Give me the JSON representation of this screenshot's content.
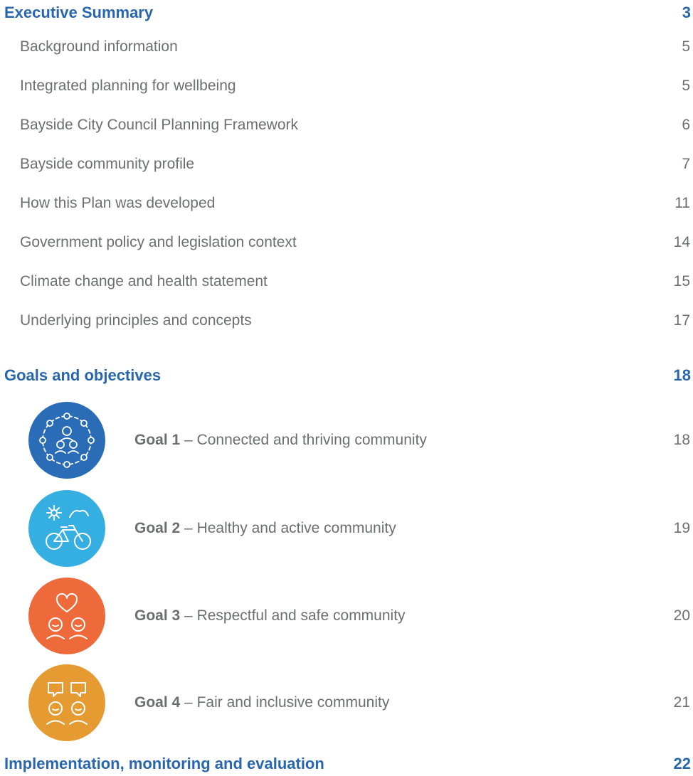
{
  "toc": {
    "executive_summary": {
      "label": "Executive Summary",
      "page": "3"
    },
    "entries": [
      {
        "label": "Background information",
        "page": "5"
      },
      {
        "label": "Integrated planning for wellbeing",
        "page": "5"
      },
      {
        "label": "Bayside City Council Planning Framework",
        "page": "6"
      },
      {
        "label": "Bayside community profile",
        "page": "7"
      },
      {
        "label": "How this Plan was developed",
        "page": "11"
      },
      {
        "label": "Government policy and legislation context",
        "page": "14"
      },
      {
        "label": "Climate change and health statement",
        "page": "15"
      },
      {
        "label": "Underlying principles and concepts",
        "page": "17"
      }
    ],
    "goals_heading": {
      "label": "Goals and objectives",
      "page": "18"
    },
    "goals": [
      {
        "number": "Goal 1",
        "separator": " – ",
        "title": "Connected and thriving community",
        "page": "18",
        "icon": "community-network-icon",
        "color": "#2a6cb5"
      },
      {
        "number": "Goal 2",
        "separator": " – ",
        "title": "Healthy and active community",
        "page": "19",
        "icon": "bicycle-sun-icon",
        "color": "#35aee2"
      },
      {
        "number": "Goal 3",
        "separator": " – ",
        "title": "Respectful and safe community",
        "page": "20",
        "icon": "heart-people-icon",
        "color": "#ee6a3a"
      },
      {
        "number": "Goal 4",
        "separator": " – ",
        "title": "Fair and inclusive community",
        "page": "21",
        "icon": "speech-people-icon",
        "color": "#e59a32"
      }
    ],
    "implementation": {
      "label": "Implementation, monitoring and evaluation",
      "page": "22"
    }
  },
  "colors": {
    "heading": "#2866ad",
    "body_text": "#6d6e71"
  }
}
